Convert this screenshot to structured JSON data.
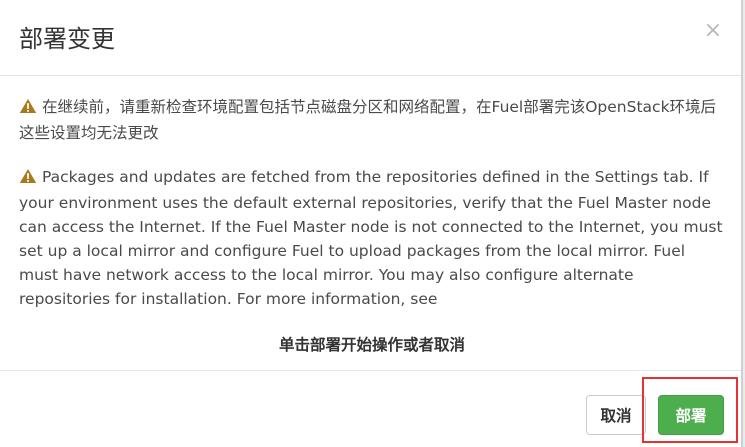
{
  "dialog": {
    "title": "部署变更",
    "close_symbol": "×"
  },
  "body": {
    "alerts": [
      {
        "icon": "warning-icon",
        "text": "在继续前，请重新检查环境配置包括节点磁盘分区和网络配置，在Fuel部署完该OpenStack环境后这些设置均无法更改"
      },
      {
        "icon": "warning-icon",
        "text": "Packages and updates are fetched from the repositories defined in the Settings tab. If your environment uses the default external repositories, verify that the Fuel Master node can access the Internet. If the Fuel Master node is not connected to the Internet, you must set up a local mirror and configure Fuel to upload packages from the local mirror. Fuel must have network access to the local mirror. You may also configure alternate repositories for installation. For more information, see"
      }
    ],
    "confirm_text": "单击部署开始操作或者取消"
  },
  "footer": {
    "cancel_label": "取消",
    "deploy_label": "部署"
  },
  "colors": {
    "warning_icon": "#a9791d",
    "deploy_button": "#4cae4c",
    "highlight": "#e53333"
  }
}
